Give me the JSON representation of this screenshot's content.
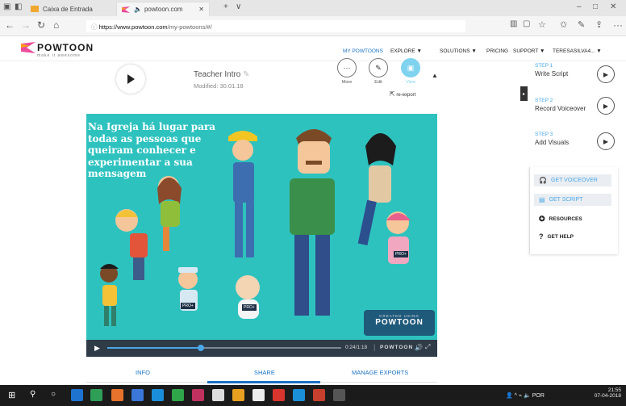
{
  "browser": {
    "tabs": [
      {
        "label": "Caixa de Entrada"
      },
      {
        "label": "powtoon.com"
      }
    ],
    "url_host": "https://www.powtoon.com",
    "url_path": "/my-powtoons/#/"
  },
  "nav": {
    "logo": "POWTOON",
    "tagline": "make it awesome",
    "links": [
      "MY POWTOONS",
      "EXPLORE ▼",
      "SOLUTIONS ▼",
      "PRICING",
      "SUPPORT ▼",
      "TERESASILVA4... ▼"
    ]
  },
  "powtoon": {
    "title": "Teacher Intro",
    "modified": "Modified: 30.01.18",
    "actions": [
      "More",
      "Edit",
      "View"
    ],
    "reexport": "re-export"
  },
  "video": {
    "caption": "Na Igreja há lugar para todas as pessoas que queiram conhecer e experimentar a sua mensagem",
    "watermark_small": "CREATED USING",
    "watermark_big": "POWTOON",
    "time": "0:24/1:18",
    "brand": "POWTOON",
    "progress": 0.4,
    "badges": [
      "PRO+",
      "PRO+",
      "PRO+"
    ]
  },
  "bottom_tabs": [
    "INFO",
    "SHARE",
    "MANAGE EXPORTS"
  ],
  "steps": [
    {
      "label": "STEP 1",
      "name": "Write Script"
    },
    {
      "label": "STEP 2",
      "name": "Record Voiceover"
    },
    {
      "label": "STEP 3",
      "name": "Add Visuals"
    }
  ],
  "resources": {
    "get_voiceover": "GET VOICEOVER",
    "get_script": "GET SCRIPT",
    "resources": "RESOURCES",
    "get_help": "GET HELP"
  },
  "tray": {
    "lang": "POR",
    "time": "21:55",
    "date": "07-04-2018"
  },
  "colors": {
    "accent": "#1b72c2",
    "video_bg": "#2ec2bf",
    "taskbar": "#1b1b1b"
  }
}
